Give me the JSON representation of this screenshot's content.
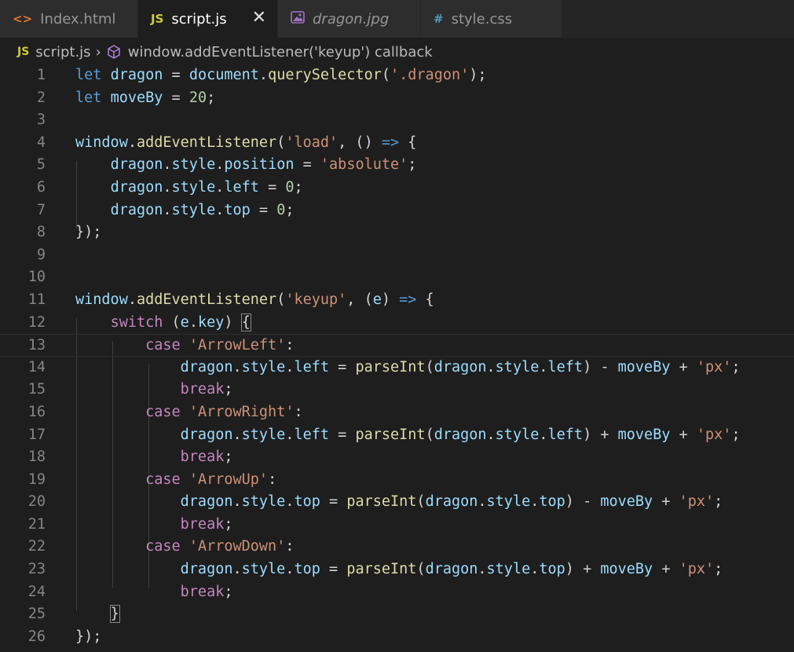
{
  "tabs": [
    {
      "label": "Index.html",
      "icon": "html-code-icon",
      "icon_glyph": "<>",
      "icon_color": "#e37933",
      "active": false,
      "italic": false
    },
    {
      "label": "script.js",
      "icon": "javascript-file-icon",
      "icon_glyph": "JS",
      "icon_color": "#cbcb41",
      "active": true,
      "italic": false,
      "close_glyph": "✕"
    },
    {
      "label": "dragon.jpg",
      "icon": "image-file-icon",
      "icon_glyph": "▣",
      "icon_color": "#a074c4",
      "active": false,
      "italic": true
    },
    {
      "label": "style.css",
      "icon": "css-file-icon",
      "icon_glyph": "#",
      "icon_color": "#519aba",
      "active": false,
      "italic": false
    }
  ],
  "breadcrumb": {
    "file_icon_glyph": "JS",
    "file": "script.js",
    "separator": "›",
    "symbol": "window.addEventListener('keyup') callback"
  },
  "colors": {
    "keyword": "#569cd6",
    "control": "#c586c0",
    "variable": "#9cdcfe",
    "function": "#dcdcaa",
    "string": "#ce9178",
    "number": "#b5cea8",
    "background": "#1e1e1e",
    "line_number": "#858585"
  },
  "editor": {
    "current_line": 13,
    "lines": [
      {
        "n": "1",
        "tokens": [
          [
            "kw",
            "let"
          ],
          [
            "op",
            " "
          ],
          [
            "var",
            "dragon"
          ],
          [
            "op",
            " = "
          ],
          [
            "var",
            "document"
          ],
          [
            "op",
            "."
          ],
          [
            "fn",
            "querySelector"
          ],
          [
            "op",
            "("
          ],
          [
            "str",
            "'.dragon'"
          ],
          [
            "op",
            ");"
          ]
        ]
      },
      {
        "n": "2",
        "tokens": [
          [
            "kw",
            "let"
          ],
          [
            "op",
            " "
          ],
          [
            "var",
            "moveBy"
          ],
          [
            "op",
            " = "
          ],
          [
            "num",
            "20"
          ],
          [
            "op",
            ";"
          ]
        ]
      },
      {
        "n": "3",
        "tokens": []
      },
      {
        "n": "4",
        "tokens": [
          [
            "var",
            "window"
          ],
          [
            "op",
            "."
          ],
          [
            "fn",
            "addEventListener"
          ],
          [
            "op",
            "("
          ],
          [
            "str",
            "'load'"
          ],
          [
            "op",
            ", () "
          ],
          [
            "kw",
            "=>"
          ],
          [
            "op",
            " {"
          ]
        ]
      },
      {
        "n": "5",
        "tokens": [
          [
            "op",
            "    "
          ],
          [
            "var",
            "dragon"
          ],
          [
            "op",
            "."
          ],
          [
            "var",
            "style"
          ],
          [
            "op",
            "."
          ],
          [
            "var",
            "position"
          ],
          [
            "op",
            " = "
          ],
          [
            "str",
            "'absolute'"
          ],
          [
            "op",
            ";"
          ]
        ]
      },
      {
        "n": "6",
        "tokens": [
          [
            "op",
            "    "
          ],
          [
            "var",
            "dragon"
          ],
          [
            "op",
            "."
          ],
          [
            "var",
            "style"
          ],
          [
            "op",
            "."
          ],
          [
            "var",
            "left"
          ],
          [
            "op",
            " = "
          ],
          [
            "num",
            "0"
          ],
          [
            "op",
            ";"
          ]
        ]
      },
      {
        "n": "7",
        "tokens": [
          [
            "op",
            "    "
          ],
          [
            "var",
            "dragon"
          ],
          [
            "op",
            "."
          ],
          [
            "var",
            "style"
          ],
          [
            "op",
            "."
          ],
          [
            "var",
            "top"
          ],
          [
            "op",
            " = "
          ],
          [
            "num",
            "0"
          ],
          [
            "op",
            ";"
          ]
        ]
      },
      {
        "n": "8",
        "tokens": [
          [
            "op",
            "});"
          ]
        ]
      },
      {
        "n": "9",
        "tokens": []
      },
      {
        "n": "10",
        "tokens": []
      },
      {
        "n": "11",
        "tokens": [
          [
            "var",
            "window"
          ],
          [
            "op",
            "."
          ],
          [
            "fn",
            "addEventListener"
          ],
          [
            "op",
            "("
          ],
          [
            "str",
            "'keyup'"
          ],
          [
            "op",
            ", ("
          ],
          [
            "var",
            "e"
          ],
          [
            "op",
            ") "
          ],
          [
            "kw",
            "=>"
          ],
          [
            "op",
            " {"
          ]
        ]
      },
      {
        "n": "12",
        "tokens": [
          [
            "op",
            "    "
          ],
          [
            "ctl",
            "switch"
          ],
          [
            "op",
            " ("
          ],
          [
            "var",
            "e"
          ],
          [
            "op",
            "."
          ],
          [
            "var",
            "key"
          ],
          [
            "op",
            ") "
          ],
          [
            "brk",
            "{"
          ]
        ]
      },
      {
        "n": "13",
        "tokens": [
          [
            "op",
            "        "
          ],
          [
            "ctl",
            "case"
          ],
          [
            "op",
            " "
          ],
          [
            "str",
            "'ArrowLeft'"
          ],
          [
            "op",
            ":"
          ]
        ]
      },
      {
        "n": "14",
        "tokens": [
          [
            "op",
            "            "
          ],
          [
            "var",
            "dragon"
          ],
          [
            "op",
            "."
          ],
          [
            "var",
            "style"
          ],
          [
            "op",
            "."
          ],
          [
            "var",
            "left"
          ],
          [
            "op",
            " = "
          ],
          [
            "fn",
            "parseInt"
          ],
          [
            "op",
            "("
          ],
          [
            "var",
            "dragon"
          ],
          [
            "op",
            "."
          ],
          [
            "var",
            "style"
          ],
          [
            "op",
            "."
          ],
          [
            "var",
            "left"
          ],
          [
            "op",
            ") - "
          ],
          [
            "var",
            "moveBy"
          ],
          [
            "op",
            " + "
          ],
          [
            "str",
            "'px'"
          ],
          [
            "op",
            ";"
          ]
        ]
      },
      {
        "n": "15",
        "tokens": [
          [
            "op",
            "            "
          ],
          [
            "ctl",
            "break"
          ],
          [
            "op",
            ";"
          ]
        ]
      },
      {
        "n": "16",
        "tokens": [
          [
            "op",
            "        "
          ],
          [
            "ctl",
            "case"
          ],
          [
            "op",
            " "
          ],
          [
            "str",
            "'ArrowRight'"
          ],
          [
            "op",
            ":"
          ]
        ]
      },
      {
        "n": "17",
        "tokens": [
          [
            "op",
            "            "
          ],
          [
            "var",
            "dragon"
          ],
          [
            "op",
            "."
          ],
          [
            "var",
            "style"
          ],
          [
            "op",
            "."
          ],
          [
            "var",
            "left"
          ],
          [
            "op",
            " = "
          ],
          [
            "fn",
            "parseInt"
          ],
          [
            "op",
            "("
          ],
          [
            "var",
            "dragon"
          ],
          [
            "op",
            "."
          ],
          [
            "var",
            "style"
          ],
          [
            "op",
            "."
          ],
          [
            "var",
            "left"
          ],
          [
            "op",
            ") + "
          ],
          [
            "var",
            "moveBy"
          ],
          [
            "op",
            " + "
          ],
          [
            "str",
            "'px'"
          ],
          [
            "op",
            ";"
          ]
        ]
      },
      {
        "n": "18",
        "tokens": [
          [
            "op",
            "            "
          ],
          [
            "ctl",
            "break"
          ],
          [
            "op",
            ";"
          ]
        ]
      },
      {
        "n": "19",
        "tokens": [
          [
            "op",
            "        "
          ],
          [
            "ctl",
            "case"
          ],
          [
            "op",
            " "
          ],
          [
            "str",
            "'ArrowUp'"
          ],
          [
            "op",
            ":"
          ]
        ]
      },
      {
        "n": "20",
        "tokens": [
          [
            "op",
            "            "
          ],
          [
            "var",
            "dragon"
          ],
          [
            "op",
            "."
          ],
          [
            "var",
            "style"
          ],
          [
            "op",
            "."
          ],
          [
            "var",
            "top"
          ],
          [
            "op",
            " = "
          ],
          [
            "fn",
            "parseInt"
          ],
          [
            "op",
            "("
          ],
          [
            "var",
            "dragon"
          ],
          [
            "op",
            "."
          ],
          [
            "var",
            "style"
          ],
          [
            "op",
            "."
          ],
          [
            "var",
            "top"
          ],
          [
            "op",
            ") - "
          ],
          [
            "var",
            "moveBy"
          ],
          [
            "op",
            " + "
          ],
          [
            "str",
            "'px'"
          ],
          [
            "op",
            ";"
          ]
        ]
      },
      {
        "n": "21",
        "tokens": [
          [
            "op",
            "            "
          ],
          [
            "ctl",
            "break"
          ],
          [
            "op",
            ";"
          ]
        ]
      },
      {
        "n": "22",
        "tokens": [
          [
            "op",
            "        "
          ],
          [
            "ctl",
            "case"
          ],
          [
            "op",
            " "
          ],
          [
            "str",
            "'ArrowDown'"
          ],
          [
            "op",
            ":"
          ]
        ]
      },
      {
        "n": "23",
        "tokens": [
          [
            "op",
            "            "
          ],
          [
            "var",
            "dragon"
          ],
          [
            "op",
            "."
          ],
          [
            "var",
            "style"
          ],
          [
            "op",
            "."
          ],
          [
            "var",
            "top"
          ],
          [
            "op",
            " = "
          ],
          [
            "fn",
            "parseInt"
          ],
          [
            "op",
            "("
          ],
          [
            "var",
            "dragon"
          ],
          [
            "op",
            "."
          ],
          [
            "var",
            "style"
          ],
          [
            "op",
            "."
          ],
          [
            "var",
            "top"
          ],
          [
            "op",
            ") + "
          ],
          [
            "var",
            "moveBy"
          ],
          [
            "op",
            " + "
          ],
          [
            "str",
            "'px'"
          ],
          [
            "op",
            ";"
          ]
        ]
      },
      {
        "n": "24",
        "tokens": [
          [
            "op",
            "            "
          ],
          [
            "ctl",
            "break"
          ],
          [
            "op",
            ";"
          ]
        ]
      },
      {
        "n": "25",
        "tokens": [
          [
            "op",
            "    "
          ],
          [
            "brk",
            "}"
          ]
        ]
      },
      {
        "n": "26",
        "tokens": [
          [
            "op",
            "});"
          ]
        ]
      }
    ]
  }
}
